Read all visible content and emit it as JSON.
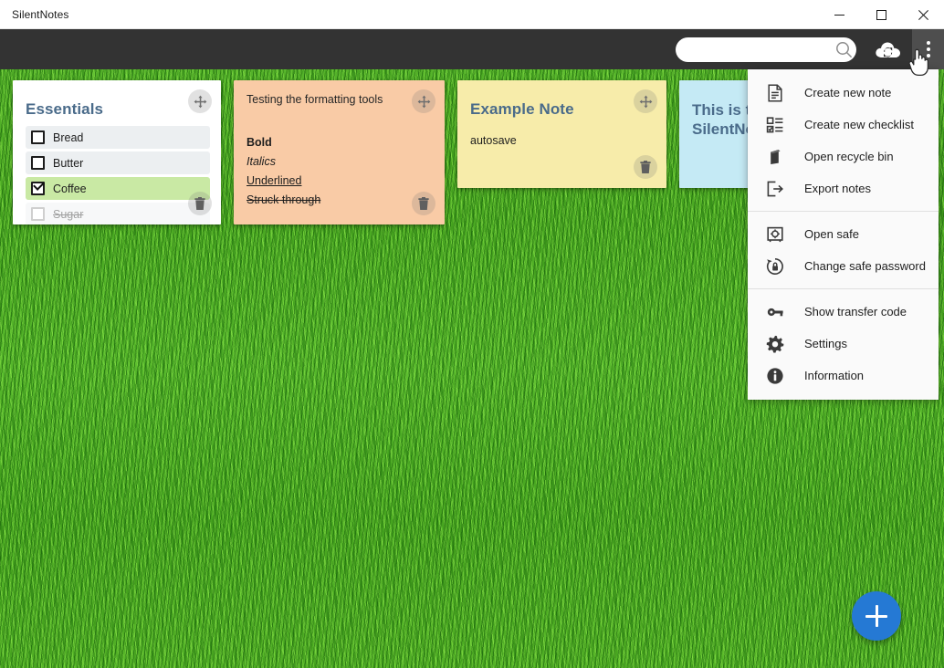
{
  "window": {
    "title": "SilentNotes",
    "controls": {
      "minimize_label": "Minimize",
      "maximize_label": "Maximize",
      "close_label": "Close"
    }
  },
  "toolbar": {
    "search_placeholder": "",
    "search_value": "",
    "search_icon": "search-icon",
    "sync_icon": "sync-cloud-icon",
    "overflow_icon": "more-vertical-icon"
  },
  "notes": [
    {
      "id": "essentials",
      "type": "checklist",
      "title": "Essentials",
      "color": "#ffffff",
      "items": [
        {
          "label": "Bread",
          "checked": false,
          "done": false
        },
        {
          "label": "Butter",
          "checked": false,
          "done": false
        },
        {
          "label": "Coffee",
          "checked": true,
          "done": false
        },
        {
          "label": "Sugar",
          "checked": false,
          "done": true
        }
      ]
    },
    {
      "id": "formatting",
      "type": "text",
      "title": "Testing the formatting tools",
      "color": "#f9cba6",
      "lines": [
        {
          "text": "Bold",
          "style": "bold"
        },
        {
          "text": "Italics",
          "style": "italic"
        },
        {
          "text": "Underlined",
          "style": "underline"
        },
        {
          "text": "Struck through",
          "style": "strikethrough"
        }
      ]
    },
    {
      "id": "example",
      "type": "text",
      "title": "Example Note",
      "color": "#f7ecaa",
      "body": "autosave"
    },
    {
      "id": "blue",
      "type": "text",
      "color": "#c5eaf5",
      "body": "This is the first note in SilentNotes"
    }
  ],
  "note_actions": {
    "move_icon": "move-handle-icon",
    "delete_icon": "trash-icon"
  },
  "fab": {
    "label": "+",
    "icon": "plus-icon",
    "color": "#2579d4"
  },
  "menu": {
    "groups": [
      {
        "items": [
          {
            "label": "Create new note",
            "icon": "document-icon"
          },
          {
            "label": "Create new checklist",
            "icon": "checklist-icon"
          },
          {
            "label": "Open recycle bin",
            "icon": "recycle-bin-icon"
          },
          {
            "label": "Export notes",
            "icon": "export-icon"
          }
        ]
      },
      {
        "items": [
          {
            "label": "Open safe",
            "icon": "safe-icon"
          },
          {
            "label": "Change safe password",
            "icon": "lock-refresh-icon"
          }
        ]
      },
      {
        "items": [
          {
            "label": "Show transfer code",
            "icon": "key-icon"
          },
          {
            "label": "Settings",
            "icon": "gear-icon"
          },
          {
            "label": "Information",
            "icon": "info-icon"
          }
        ]
      }
    ]
  },
  "theme": {
    "titlebar_bg": "#ffffff",
    "toolbar_bg": "#333333",
    "overflow_bg": "#4e4e4e",
    "accent_blue": "#2579d4",
    "note_title_color": "#4a6b8a",
    "checked_row_bg": "#c9e9a4",
    "row_bg": "#eceff1",
    "background": "grass-texture-green"
  }
}
